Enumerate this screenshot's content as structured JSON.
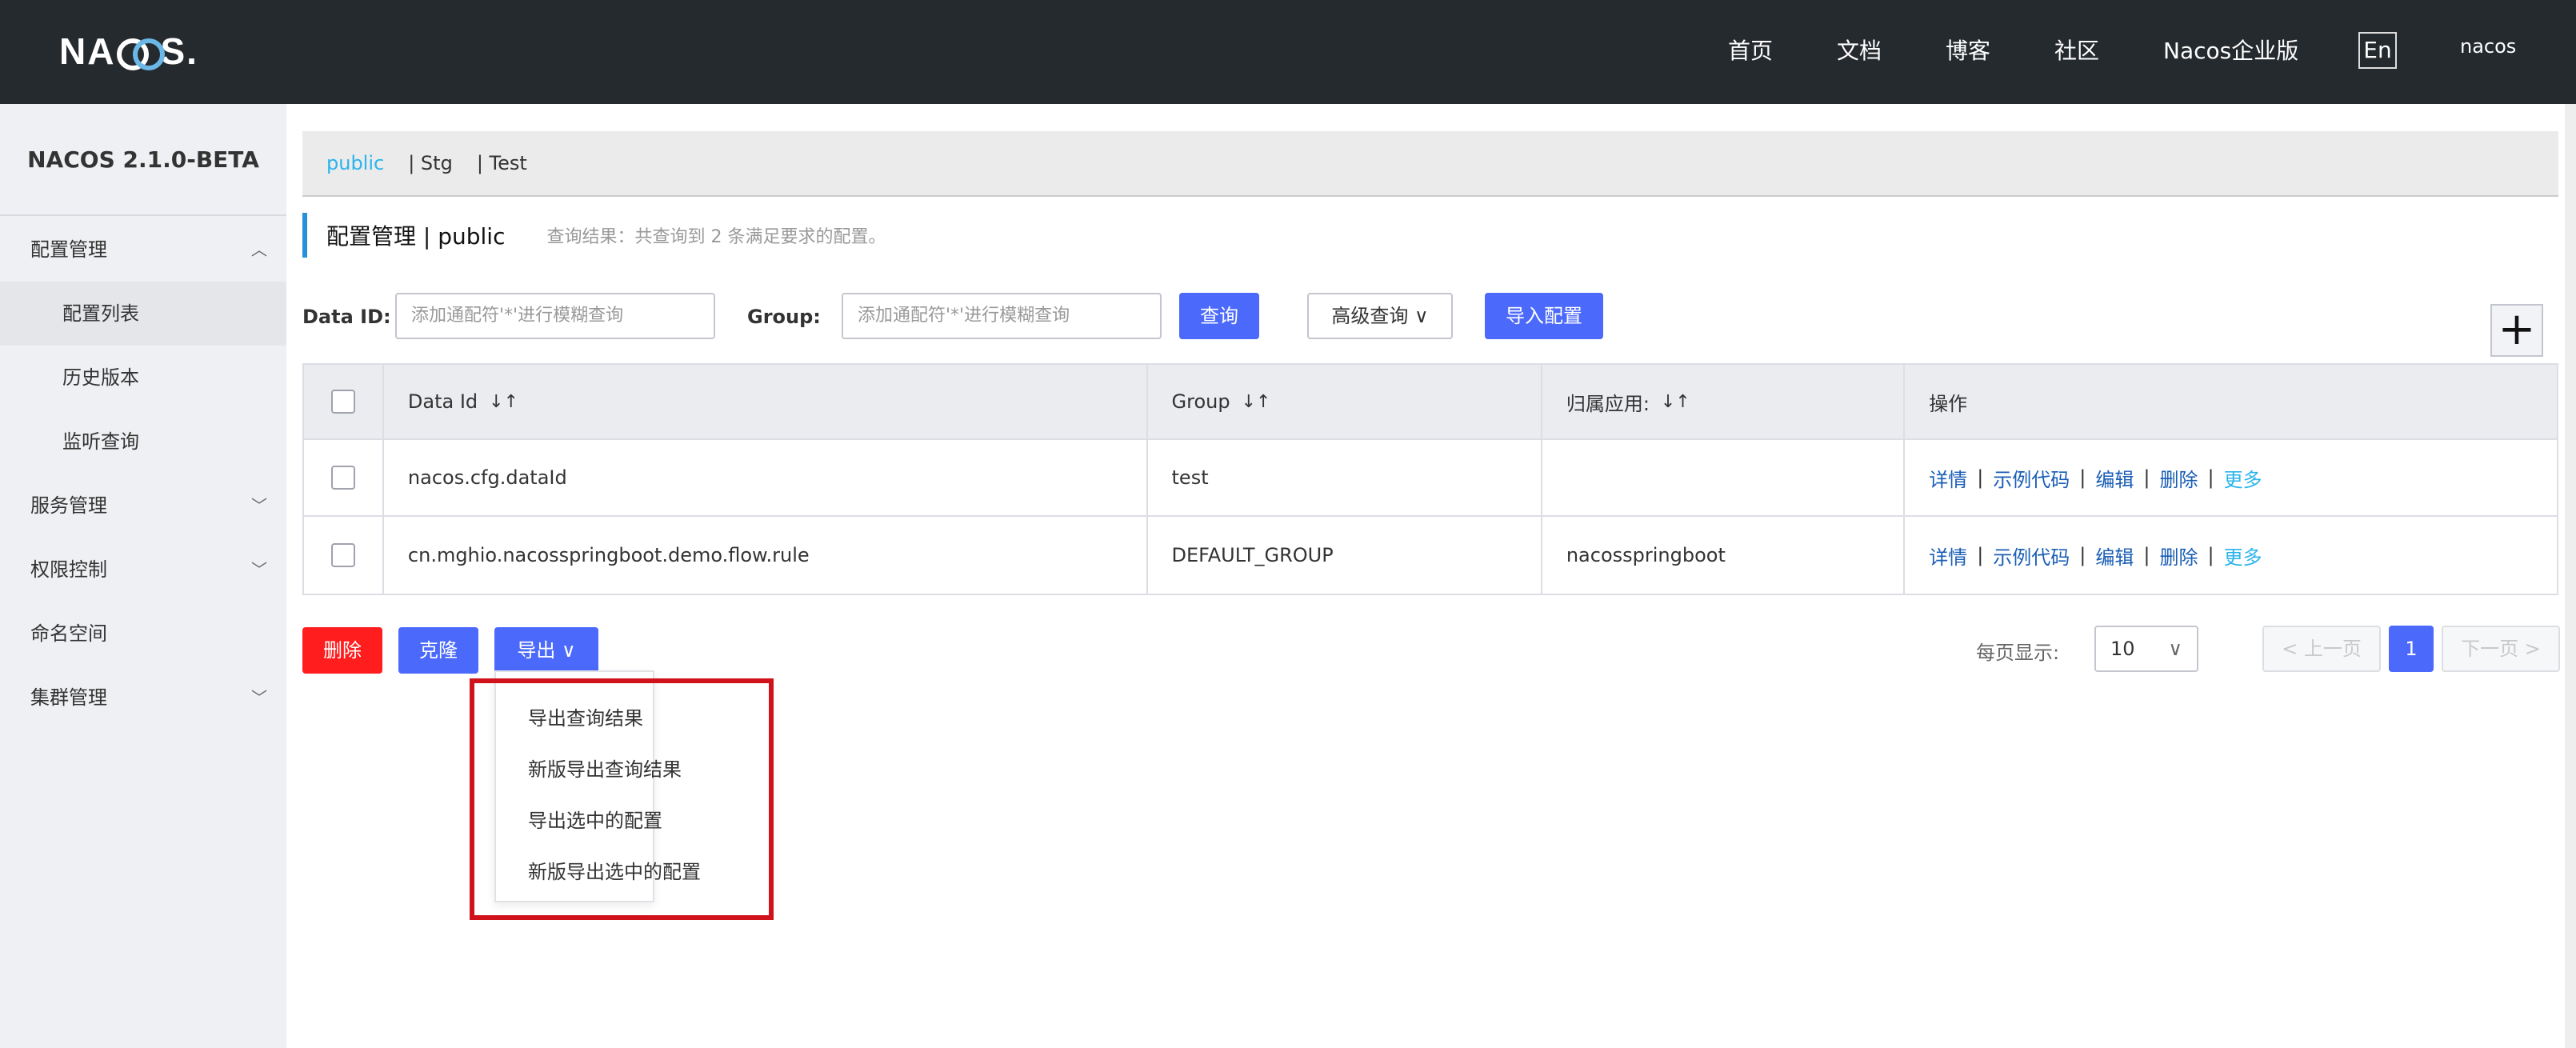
{
  "brand": {
    "logo": "NACOS."
  },
  "topnav": {
    "items": [
      "首页",
      "文档",
      "博客",
      "社区",
      "Nacos企业版"
    ],
    "lang": "En",
    "user": "nacos"
  },
  "sidebar": {
    "title": "NACOS 2.1.0-BETA",
    "items": [
      {
        "label": "配置管理",
        "expanded": true
      },
      {
        "label": "配置列表"
      },
      {
        "label": "历史版本"
      },
      {
        "label": "监听查询"
      },
      {
        "label": "服务管理"
      },
      {
        "label": "权限控制"
      },
      {
        "label": "命名空间"
      },
      {
        "label": "集群管理"
      }
    ]
  },
  "namespaces": [
    "public",
    "| Stg",
    "| Test"
  ],
  "page": {
    "title": "配置管理  |  public",
    "result_hint": "查询结果：共查询到 2 条满足要求的配置。"
  },
  "search": {
    "dataid_label": "Data ID:",
    "dataid_placeholder": "添加通配符'*'进行模糊查询",
    "group_label": "Group:",
    "group_placeholder": "添加通配符'*'进行模糊查询",
    "query_btn": "查询",
    "advanced_btn": "高级查询",
    "import_btn": "导入配置",
    "add_btn": "+"
  },
  "table": {
    "headers": [
      "Data Id",
      "Group",
      "归属应用:",
      "操作"
    ],
    "rows": [
      {
        "data_id": "nacos.cfg.dataId",
        "group": "test",
        "app": ""
      },
      {
        "data_id": "cn.mghio.nacosspringboot.demo.flow.rule",
        "group": "DEFAULT_GROUP",
        "app": "nacosspringboot"
      }
    ],
    "ops": {
      "detail": "详情",
      "sample": "示例代码",
      "edit": "编辑",
      "delete": "删除",
      "more": "更多"
    }
  },
  "actions": {
    "delete": "删除",
    "clone": "克隆",
    "export": "导出"
  },
  "pagination": {
    "page_size_label": "每页显示:",
    "page_size": "10",
    "prev": "上一页",
    "current": "1",
    "next": "下一页"
  },
  "export_menu": [
    "导出查询结果",
    "新版导出查询结果",
    "导出选中的配置",
    "新版导出选中的配置"
  ],
  "colors": {
    "primary": "#4b69fa",
    "danger": "#ff1d1d",
    "link": "#1a5eb5",
    "accent": "#2bb4ed",
    "highlight": "#d0121b"
  }
}
